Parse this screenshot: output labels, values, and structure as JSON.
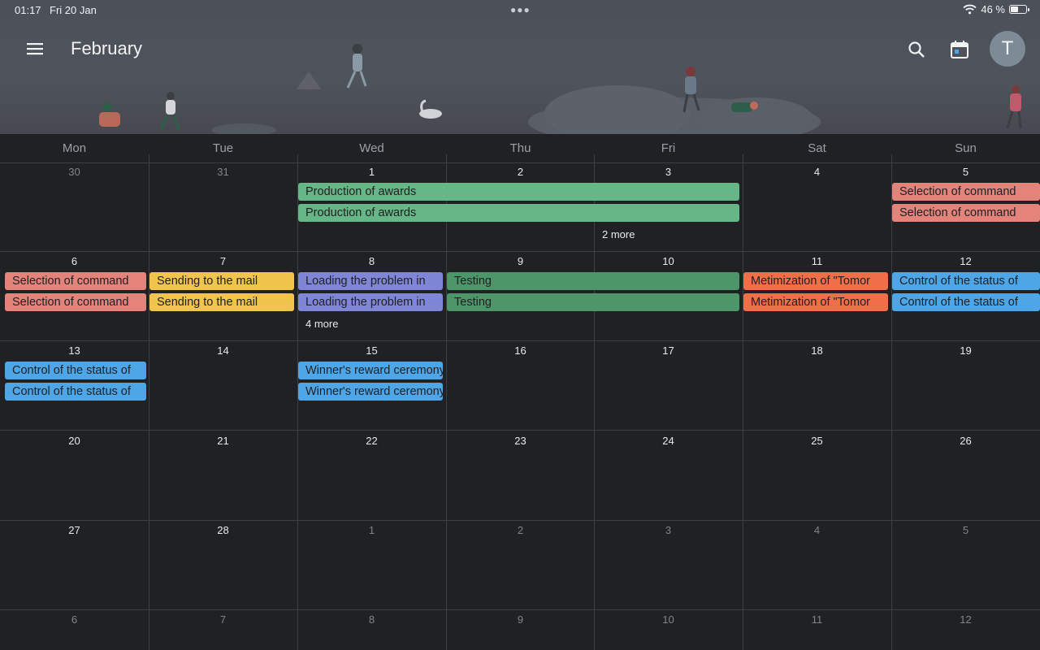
{
  "status_bar": {
    "time": "01:17",
    "date": "Fri 20 Jan",
    "battery": "46 %",
    "battery_level": 0.46
  },
  "header": {
    "month": "February",
    "avatar_initial": "T"
  },
  "colors": {
    "green": "#67b686",
    "dark_green": "#4d9669",
    "salmon": "#e3837a",
    "yellow": "#f0c44d",
    "purple": "#7f86d6",
    "orange": "#ef7048",
    "blue": "#4ea6e6"
  },
  "weekdays": [
    "Mon",
    "Tue",
    "Wed",
    "Thu",
    "Fri",
    "Sat",
    "Sun"
  ],
  "weeks": [
    [
      "30",
      "31",
      "1",
      "2",
      "3",
      "4",
      "5"
    ],
    [
      "6",
      "7",
      "8",
      "9",
      "10",
      "11",
      "12"
    ],
    [
      "13",
      "14",
      "15",
      "16",
      "17",
      "18",
      "19"
    ],
    [
      "20",
      "21",
      "22",
      "23",
      "24",
      "25",
      "26"
    ],
    [
      "27",
      "28",
      "1",
      "2",
      "3",
      "4",
      "5"
    ],
    [
      "6",
      "7",
      "8",
      "9",
      "10",
      "11",
      "12"
    ]
  ],
  "events": {
    "w1_production_1": "Production of awards",
    "w1_production_2": "Production of awards",
    "w1_more": "2 more",
    "w1_selection_1": "Selection of command",
    "w1_selection_2": "Selection of command",
    "w2_selection_1": "Selection of command",
    "w2_selection_2": "Selection of command",
    "w2_mail_1": "Sending to the mail",
    "w2_mail_2": "Sending to the mail",
    "w2_loading_1": "Loading the problem in",
    "w2_loading_2": "Loading the problem in",
    "w2_more": "4 more",
    "w2_testing_1": "Testing",
    "w2_testing_2": "Testing",
    "w2_metimization_1": "Metimization of \"Tomor",
    "w2_metimization_2": "Metimization of \"Tomor",
    "w2_control_1": "Control of the status of",
    "w2_control_2": "Control of the status of",
    "w3_control_1": "Control of the status of",
    "w3_control_2": "Control of the status of",
    "w3_winner_1": "Winner's reward ceremony",
    "w3_winner_2": "Winner's reward ceremony"
  }
}
